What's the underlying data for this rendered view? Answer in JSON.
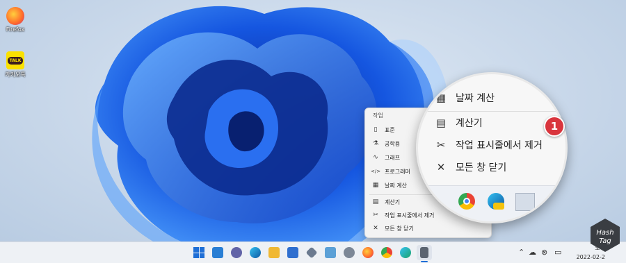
{
  "desktop": {
    "icons": [
      {
        "label": "Firefox",
        "icon": "firefox-icon"
      },
      {
        "label": "카카오톡",
        "icon": "kakaotalk-icon",
        "badge": "TALK"
      }
    ]
  },
  "jumplist": {
    "section_title": "작업",
    "tasks": [
      {
        "label": "표준",
        "icon": "standard-calculator-icon",
        "glyph": "▯"
      },
      {
        "label": "공학용",
        "icon": "flask-icon",
        "glyph": "⚗"
      },
      {
        "label": "그래프",
        "icon": "graph-icon",
        "glyph": "∿"
      },
      {
        "label": "프로그래머",
        "icon": "code-icon",
        "glyph": "</>"
      },
      {
        "label": "날짜 계산",
        "icon": "calendar-icon",
        "glyph": "▦"
      }
    ],
    "actions": [
      {
        "label": "계산기",
        "icon": "calculator-icon",
        "glyph": "▤"
      },
      {
        "label": "작업 표시줄에서 제거",
        "icon": "unpin-icon",
        "glyph": "✂"
      },
      {
        "label": "모든 창 닫기",
        "icon": "close-icon",
        "glyph": "✕"
      }
    ]
  },
  "magnifier": {
    "items": [
      {
        "label": "날짜 계산",
        "icon": "calendar-icon",
        "glyph": "▦"
      },
      {
        "label": "계산기",
        "icon": "calculator-icon",
        "glyph": "▤"
      },
      {
        "label": "작업 표시줄에서 제거",
        "icon": "unpin-icon",
        "glyph": "✂"
      },
      {
        "label": "모든 창 닫기",
        "icon": "close-icon",
        "glyph": "✕"
      }
    ],
    "step_badge": "1"
  },
  "taskbar": {
    "apps": [
      {
        "name": "start-button",
        "color": "#1f6fd6"
      },
      {
        "name": "widgets-button",
        "color": "#2a7fd4"
      },
      {
        "name": "teams-chat-button",
        "color": "#6264a7"
      },
      {
        "name": "edge-button",
        "color": "#1a9ad9"
      },
      {
        "name": "file-explorer-button",
        "color": "#f0b833"
      },
      {
        "name": "mail-button",
        "color": "#2f6fcf"
      },
      {
        "name": "settings-pinwheel-button",
        "color": "#6b7a8f"
      },
      {
        "name": "notepad-button",
        "color": "#5ba0d6"
      },
      {
        "name": "settings-button",
        "color": "#7c8796"
      },
      {
        "name": "firefox-button",
        "color": "#ff7139"
      },
      {
        "name": "chrome-button",
        "color": "#34a853"
      },
      {
        "name": "edge-canary-button",
        "color": "#1ba36d"
      },
      {
        "name": "calculator-button",
        "color": "#5b6470"
      }
    ],
    "clock_time": "오후",
    "clock_date": "2022-02-2"
  },
  "watermark": {
    "text_line1": "Hash",
    "text_line2": "Tag"
  }
}
